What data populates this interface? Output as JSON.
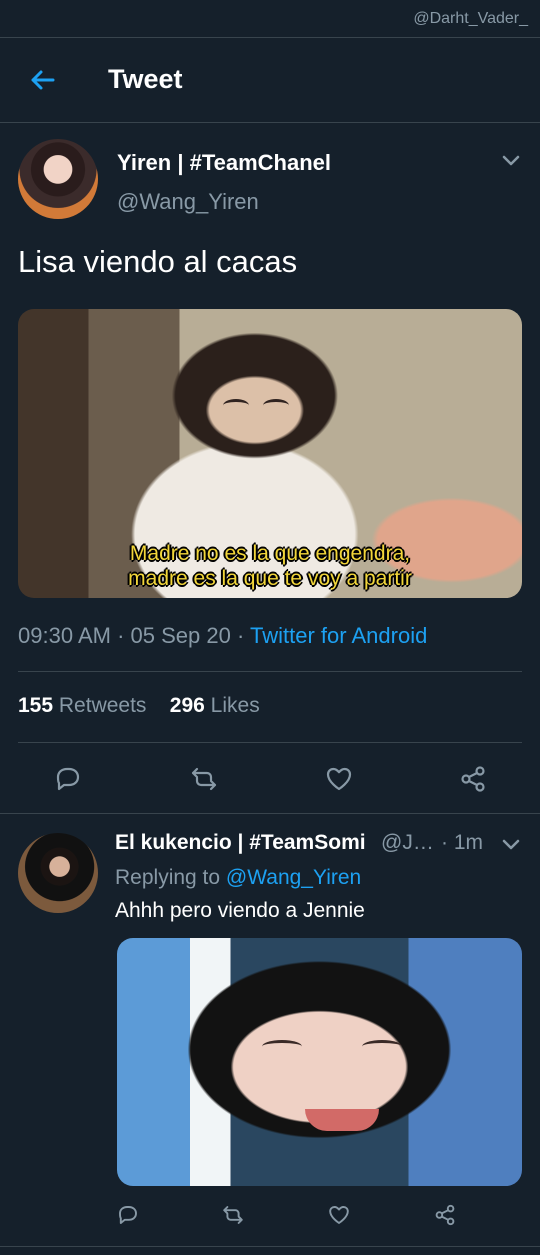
{
  "watermark": "@Darht_Vader_",
  "header": {
    "title": "Tweet",
    "back_icon": "arrow-left-icon"
  },
  "main_tweet": {
    "display_name": "Yiren | #TeamChanel",
    "handle": "@Wang_Yiren",
    "text": "Lisa viendo al cacas",
    "media_caption_line_1": "Madre no es la que engendra,",
    "media_caption_line_2": "madre es la que te voy a partir",
    "time": "09:30 AM",
    "separator_1": "·",
    "date": "05 Sep 20",
    "separator_2": "·",
    "source": "Twitter for Android",
    "retweets_count": "155",
    "retweets_label": "Retweets",
    "likes_count": "296",
    "likes_label": "Likes",
    "actions": [
      "reply-icon",
      "retweet-icon",
      "like-icon",
      "share-icon"
    ]
  },
  "reply_tweet": {
    "display_name": "El kukencio | #TeamSomi",
    "handle": "@J…",
    "time": "· 1m",
    "replying_to_label": "Replying to",
    "replying_to_handle": "@Wang_Yiren",
    "text": "Ahhh pero viendo a Jennie",
    "actions": [
      "reply-icon",
      "retweet-icon",
      "like-icon",
      "share-icon"
    ]
  },
  "colors": {
    "background": "#15202b",
    "border": "#38444d",
    "muted_text": "#8899a6",
    "accent": "#1da1f2"
  }
}
